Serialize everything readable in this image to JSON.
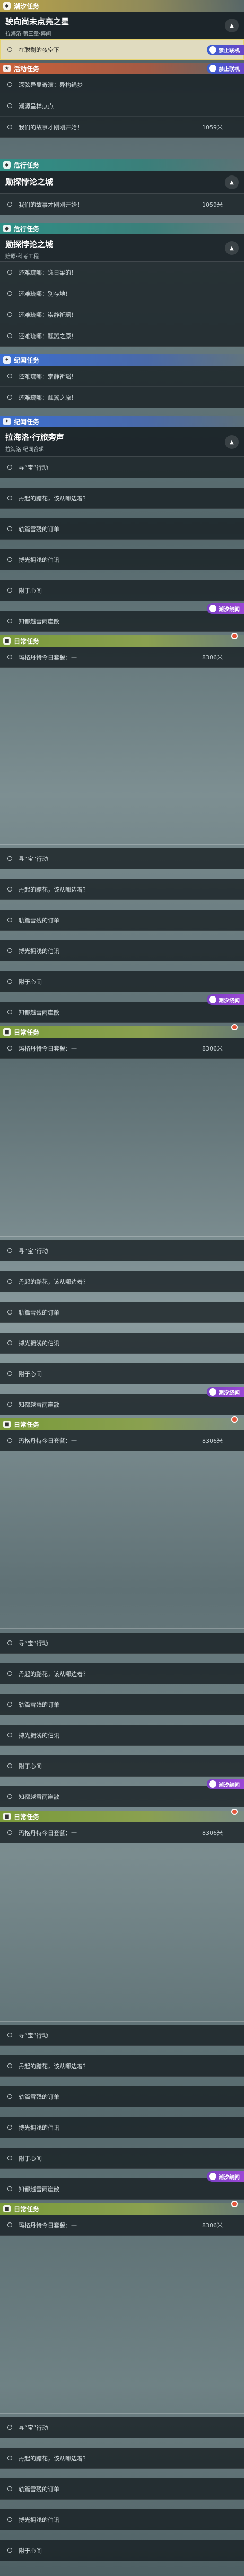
{
  "header": {
    "section": "潮汐任务"
  },
  "top_card": {
    "title": "驶向尚未点亮之星",
    "sub": "拉海洛·第三章·幕间"
  },
  "dest": {
    "label": "在聪剩的夜空下",
    "badge": "禁止联机"
  },
  "activity": {
    "section": "活动任务",
    "badge": "禁止联机",
    "rows": [
      "深弦异显奇演：异构绳梦",
      "潮源呈样点点",
      "我们的故事才刚刚开始！"
    ],
    "dist": "1059米"
  },
  "side1": {
    "section": "危行任务",
    "title": "勋探悖论之城",
    "rows": [
      "我们的故事才刚刚开始！"
    ],
    "dist": "1059米"
  },
  "side2": {
    "section": "危行任务",
    "title": "勋探悖论之城",
    "sub": "赔原·科考工程",
    "rows": [
      "还难琉哪：逸日梁的！",
      "还难琉哪：别存地！",
      "还难琉哪：崇静祈瑶！",
      "还难琉哪：瓢嚣之原！"
    ]
  },
  "memory": {
    "section": "纪闻任务",
    "rows": [
      "还难琉哪：崇静祈瑶！",
      "还难琉哪：瓢嚣之原！"
    ]
  },
  "memory_card": {
    "title": "拉海洛·行旅旁声",
    "sub": "拉海洛·纪闻合辑"
  },
  "repeat": {
    "rows": [
      "寻“宝”行动",
      "丹起的黯花，该从哪边着？",
      "轨篇雪残的订单",
      "搏光拥浅的伯讯",
      "附于心间"
    ],
    "extra": "知都越雪雨崖散",
    "tag": "潮汐绕闻",
    "daily_section": "日常任务",
    "daily_row": "玛格丹特今日套餐：一",
    "daily_dist": "8306米"
  }
}
